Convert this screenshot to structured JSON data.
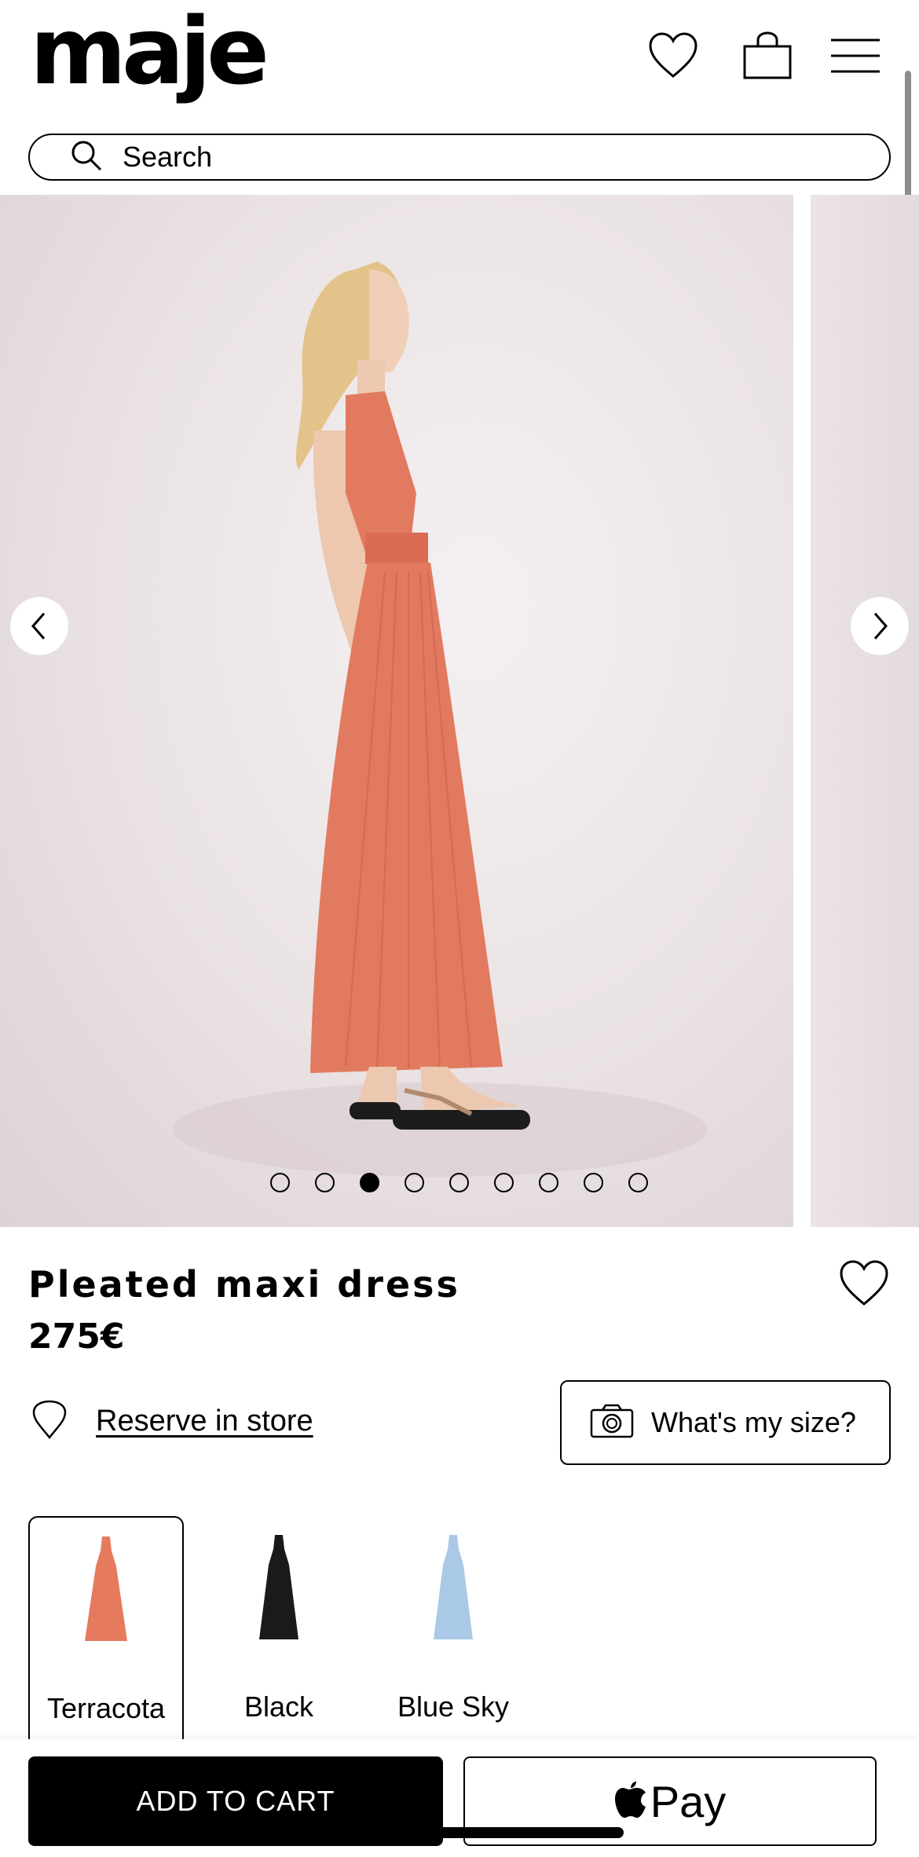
{
  "brand": {
    "logo": "maje"
  },
  "header": {
    "icons": [
      "heart-icon",
      "shopping-bag-icon",
      "menu-icon"
    ]
  },
  "search": {
    "placeholder": "Search"
  },
  "gallery": {
    "current_slide": 3,
    "total_slides": 9,
    "colors": {
      "background": "#ece5e6",
      "dress": "#e57a5f"
    }
  },
  "product": {
    "title": "Pleated maxi dress",
    "price": "275€",
    "reserve_label": "Reserve in store",
    "size_label": "What's my size?"
  },
  "colors": [
    {
      "name": "Terracota",
      "hex": "#e57a5f",
      "selected": true
    },
    {
      "name": "Black",
      "hex": "#1a1a1a",
      "selected": false
    },
    {
      "name": "Blue Sky",
      "hex": "#a9c9e6",
      "selected": false
    }
  ],
  "actions": {
    "add_to_cart": "ADD TO CART",
    "pay_label": "Pay"
  }
}
